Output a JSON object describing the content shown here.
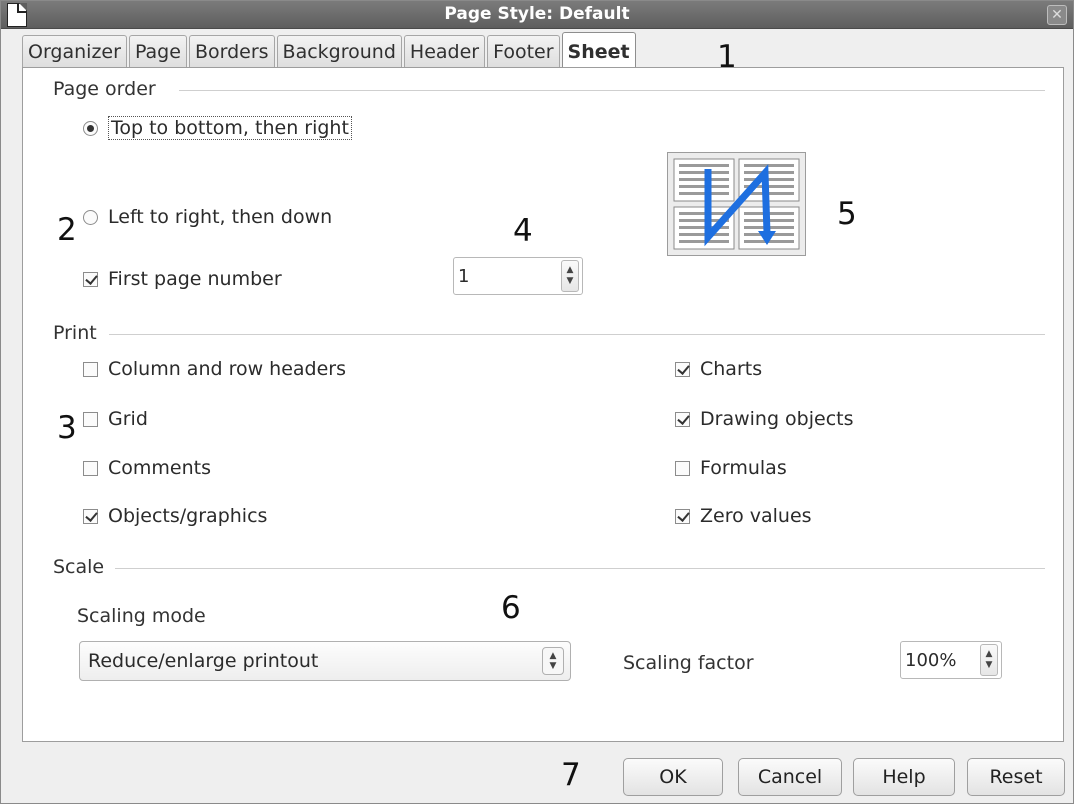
{
  "window": {
    "title": "Page Style: Default",
    "close_label": "✕"
  },
  "tabs": [
    {
      "label": "Organizer",
      "active": false
    },
    {
      "label": "Page",
      "active": false
    },
    {
      "label": "Borders",
      "active": false
    },
    {
      "label": "Background",
      "active": false
    },
    {
      "label": "Header",
      "active": false
    },
    {
      "label": "Footer",
      "active": false
    },
    {
      "label": "Sheet",
      "active": true
    }
  ],
  "callouts": {
    "c1": "1",
    "c2": "2",
    "c3": "3",
    "c4": "4",
    "c5": "5",
    "c6": "6",
    "c7": "7"
  },
  "page_order": {
    "label": "Page order",
    "options": [
      {
        "label": "Top to bottom, then right",
        "selected": true
      },
      {
        "label": "Left to right, then down",
        "selected": false
      }
    ],
    "first_page_number": {
      "label": "First page number",
      "checked": true,
      "value": "1"
    },
    "preview_icon": "page-order-preview-icon"
  },
  "print": {
    "label": "Print",
    "left": [
      {
        "label": "Column and row headers",
        "checked": false
      },
      {
        "label": "Grid",
        "checked": false
      },
      {
        "label": "Comments",
        "checked": false
      },
      {
        "label": "Objects/graphics",
        "checked": true
      }
    ],
    "right": [
      {
        "label": "Charts",
        "checked": true
      },
      {
        "label": "Drawing objects",
        "checked": true
      },
      {
        "label": "Formulas",
        "checked": false
      },
      {
        "label": "Zero values",
        "checked": true
      }
    ]
  },
  "scale": {
    "label": "Scale",
    "mode_label": "Scaling mode",
    "mode_value": "Reduce/enlarge printout",
    "factor_label": "Scaling factor",
    "factor_value": "100%"
  },
  "buttons": {
    "ok": "OK",
    "cancel": "Cancel",
    "help": "Help",
    "reset": "Reset"
  },
  "colors": {
    "titlebar": "#6b6b6b",
    "preview_arrow": "#1e6fe0"
  }
}
